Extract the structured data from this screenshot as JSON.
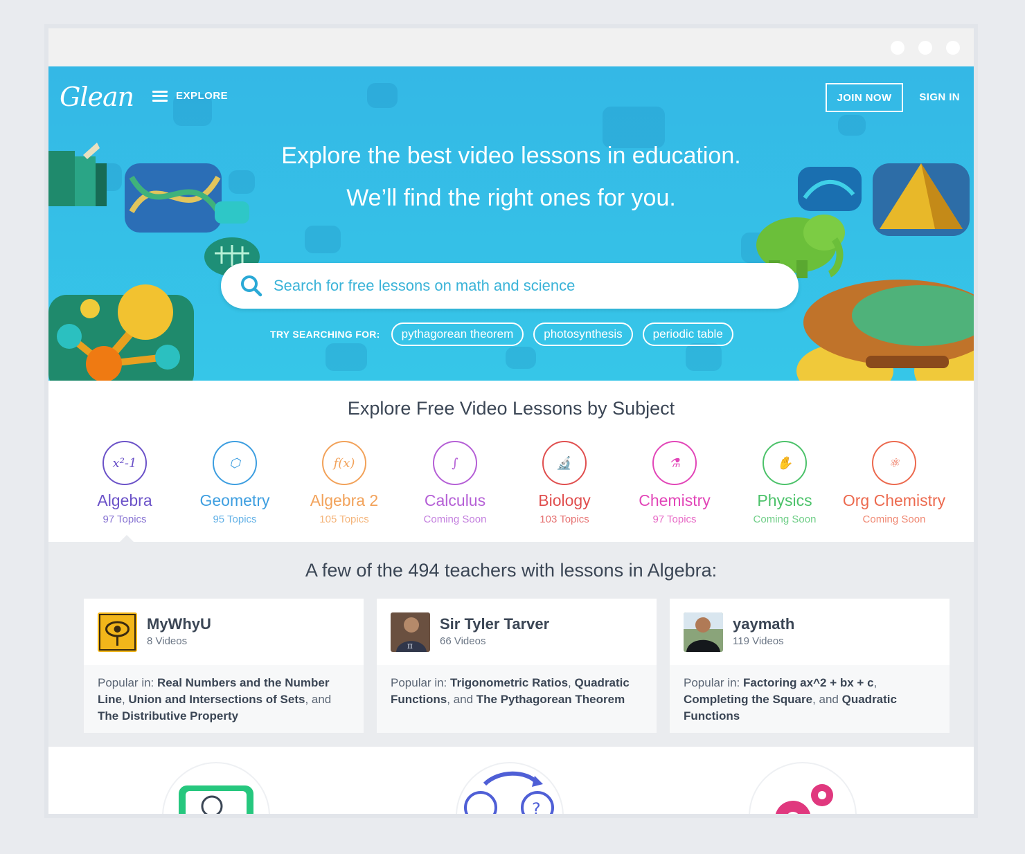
{
  "nav": {
    "logo": "Glean",
    "explore": "EXPLORE",
    "join": "JOIN NOW",
    "signin": "SIGN IN"
  },
  "hero": {
    "line1": "Explore the best video lessons in education.",
    "line2": "We’ll find the right ones for you.",
    "search_placeholder": "Search for free lessons on math and science",
    "try_label": "TRY SEARCHING FOR:",
    "suggestions": [
      "pythagorean theorem",
      "photosynthesis",
      "periodic table"
    ]
  },
  "subjects": {
    "title": "Explore Free Video Lessons by Subject",
    "items": [
      {
        "name": "Algebra",
        "sub": "97 Topics",
        "color": "#6b52c8",
        "glyph": "x²-1"
      },
      {
        "name": "Geometry",
        "sub": "95 Topics",
        "color": "#3d9ee0",
        "glyph": "⬡"
      },
      {
        "name": "Algebra 2",
        "sub": "105 Topics",
        "color": "#f2a25a",
        "glyph": "f(x)"
      },
      {
        "name": "Calculus",
        "sub": "Coming Soon",
        "color": "#b560d6",
        "glyph": "∫"
      },
      {
        "name": "Biology",
        "sub": "103 Topics",
        "color": "#e04f4f",
        "glyph": "🔬"
      },
      {
        "name": "Chemistry",
        "sub": "97 Topics",
        "color": "#e246b8",
        "glyph": "⚗"
      },
      {
        "name": "Physics",
        "sub": "Coming Soon",
        "color": "#4cc26a",
        "glyph": "✋"
      },
      {
        "name": "Org Chemistry",
        "sub": "Coming Soon",
        "color": "#ec6a4f",
        "glyph": "⚛"
      }
    ]
  },
  "teachers": {
    "title": "A few of the 494 teachers with lessons in Algebra:",
    "cards": [
      {
        "name": "MyWhyU",
        "count": "8 Videos",
        "popular_label": "Popular in:",
        "topics": [
          "Real Numbers and the Number Line",
          "Union and Intersections of Sets",
          "The Distributive Property"
        ]
      },
      {
        "name": "Sir Tyler Tarver",
        "count": "66 Videos",
        "popular_label": "Popular in:",
        "topics": [
          "Trigonometric Ratios",
          "Quadratic Functions",
          "The Pythagorean Theorem"
        ]
      },
      {
        "name": "yaymath",
        "count": "119 Videos",
        "popular_label": "Popular in:",
        "topics": [
          "Factoring ax^2 + bx + c",
          "Completing the Square",
          "Quadratic Functions"
        ]
      }
    ]
  },
  "colors": {
    "hero": "#34b8e6",
    "text": "#3b4655"
  },
  "icons": [
    "search-icon",
    "hamburger-icon",
    "lightbulb-screen-icon",
    "brain-question-icon",
    "gears-icon"
  ]
}
